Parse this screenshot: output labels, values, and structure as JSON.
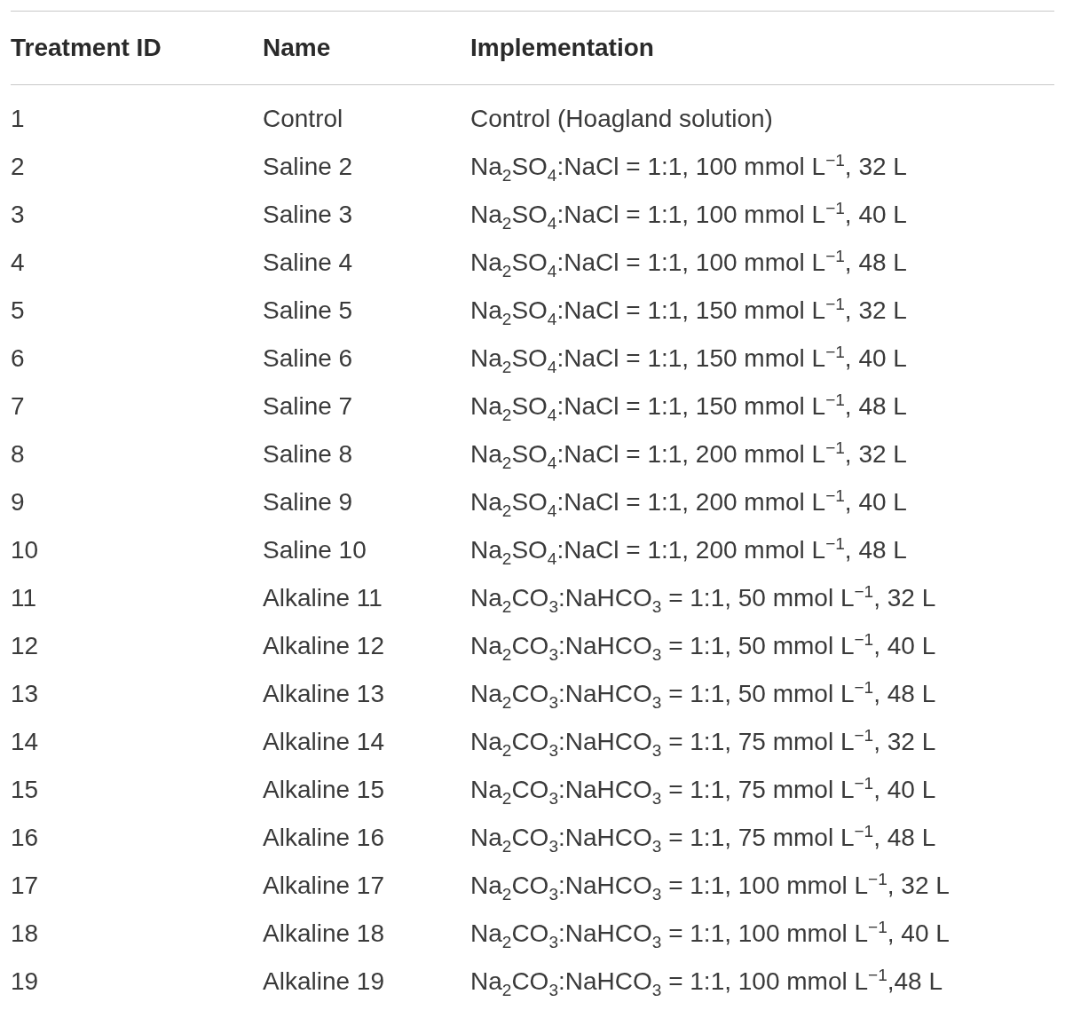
{
  "table": {
    "columns": [
      "Treatment ID",
      "Name",
      "Implementation"
    ],
    "rows": [
      {
        "id": "1",
        "name": "Control",
        "implementation": "Control (Hoagland solution)"
      },
      {
        "id": "2",
        "name": "Saline 2",
        "implementation": "Na$_{2}$SO$_{4}$:NaCl = 1:1, 100 mmol L$^{−1}$, 32 L"
      },
      {
        "id": "3",
        "name": "Saline 3",
        "implementation": "Na$_{2}$SO$_{4}$:NaCl = 1:1, 100 mmol L$^{−1}$, 40 L"
      },
      {
        "id": "4",
        "name": "Saline 4",
        "implementation": "Na$_{2}$SO$_{4}$:NaCl = 1:1, 100 mmol L$^{−1}$, 48 L"
      },
      {
        "id": "5",
        "name": "Saline 5",
        "implementation": "Na$_{2}$SO$_{4}$:NaCl = 1:1, 150 mmol L$^{−1}$, 32 L"
      },
      {
        "id": "6",
        "name": "Saline 6",
        "implementation": "Na$_{2}$SO$_{4}$:NaCl = 1:1, 150 mmol L$^{−1}$, 40 L"
      },
      {
        "id": "7",
        "name": "Saline 7",
        "implementation": "Na$_{2}$SO$_{4}$:NaCl = 1:1, 150 mmol L$^{−1}$, 48 L"
      },
      {
        "id": "8",
        "name": "Saline 8",
        "implementation": "Na$_{2}$SO$_{4}$:NaCl = 1:1, 200 mmol L$^{−1}$, 32 L"
      },
      {
        "id": "9",
        "name": "Saline 9",
        "implementation": "Na$_{2}$SO$_{4}$:NaCl = 1:1, 200 mmol L$^{−1}$, 40 L"
      },
      {
        "id": "10",
        "name": "Saline 10",
        "implementation": "Na$_{2}$SO$_{4}$:NaCl = 1:1, 200 mmol L$^{−1}$, 48 L"
      },
      {
        "id": "11",
        "name": "Alkaline 11",
        "implementation": "Na$_{2}$CO$_{3}$:NaHCO$_{3}$ = 1:1, 50 mmol L$^{−1}$, 32 L"
      },
      {
        "id": "12",
        "name": "Alkaline 12",
        "implementation": "Na$_{2}$CO$_{3}$:NaHCO$_{3}$ = 1:1, 50 mmol L$^{−1}$, 40 L"
      },
      {
        "id": "13",
        "name": "Alkaline 13",
        "implementation": "Na$_{2}$CO$_{3}$:NaHCO$_{3}$ = 1:1, 50 mmol L$^{−1}$, 48 L"
      },
      {
        "id": "14",
        "name": "Alkaline 14",
        "implementation": "Na$_{2}$CO$_{3}$:NaHCO$_{3}$ = 1:1, 75 mmol L$^{−1}$, 32 L"
      },
      {
        "id": "15",
        "name": "Alkaline 15",
        "implementation": "Na$_{2}$CO$_{3}$:NaHCO$_{3}$ = 1:1, 75 mmol L$^{−1}$, 40 L"
      },
      {
        "id": "16",
        "name": "Alkaline 16",
        "implementation": "Na$_{2}$CO$_{3}$:NaHCO$_{3}$ = 1:1, 75 mmol L$^{−1}$, 48 L"
      },
      {
        "id": "17",
        "name": "Alkaline 17",
        "implementation": "Na$_{2}$CO$_{3}$:NaHCO$_{3}$ = 1:1, 100 mmol L$^{−1}$, 32 L"
      },
      {
        "id": "18",
        "name": "Alkaline 18",
        "implementation": "Na$_{2}$CO$_{3}$:NaHCO$_{3}$ = 1:1, 100 mmol L$^{−1}$, 40 L"
      },
      {
        "id": "19",
        "name": "Alkaline 19",
        "implementation": "Na$_{2}$CO$_{3}$:NaHCO$_{3}$ = 1:1, 100 mmol L$^{−1}$,48 L"
      }
    ]
  }
}
